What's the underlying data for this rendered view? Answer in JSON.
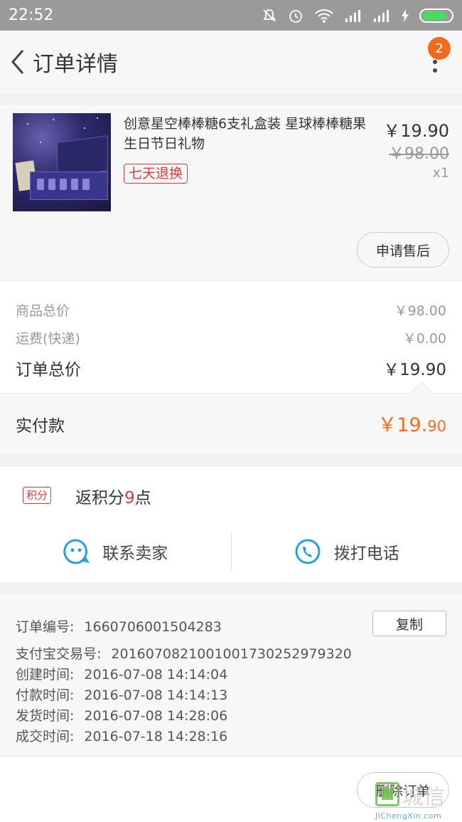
{
  "status_bar": {
    "time": "22:52"
  },
  "header": {
    "title": "订单详情",
    "badge_count": "2"
  },
  "product": {
    "title": "创意星空棒棒糖6支礼盒装 星球棒棒糖果生日节日礼物",
    "tag": "七天退换",
    "price": "￥19.90",
    "original_price": "￥98.00",
    "quantity": "x1",
    "after_sale_button": "申请售后"
  },
  "summary": {
    "goods_total_label": "商品总价",
    "goods_total_value": "￥98.00",
    "shipping_label": "运费(快递)",
    "shipping_value": "￥0.00",
    "order_total_label": "订单总价",
    "order_total_value": "￥19.90"
  },
  "payment": {
    "label": "实付款",
    "amount_int": "￥19.",
    "amount_dec": "90",
    "accent_color": "#f26a1b"
  },
  "points": {
    "tag": "积分",
    "prefix": "返积分",
    "value": "9",
    "suffix": "点"
  },
  "contact": {
    "seller": "联系卖家",
    "call": "拨打电话",
    "icon_color": "#2a9de0"
  },
  "order_info": {
    "order_no_label": "订单编号:",
    "order_no": "1660706001504283",
    "copy_button": "复制",
    "alipay_label": "支付宝交易号:",
    "alipay_no": "2016070821001001730252979320",
    "created_label": "创建时间:",
    "created": "2016-07-08 14:14:04",
    "paid_label": "付款时间:",
    "paid": "2016-07-08 14:14:13",
    "shipped_label": "发货时间:",
    "shipped": "2016-07-08 14:28:06",
    "done_label": "成交时间:",
    "done": "2016-07-18 14:28:16"
  },
  "bottom": {
    "delete_button": "删除订单"
  },
  "watermark": {
    "text": "城信",
    "url": "JiChengXin.com"
  }
}
